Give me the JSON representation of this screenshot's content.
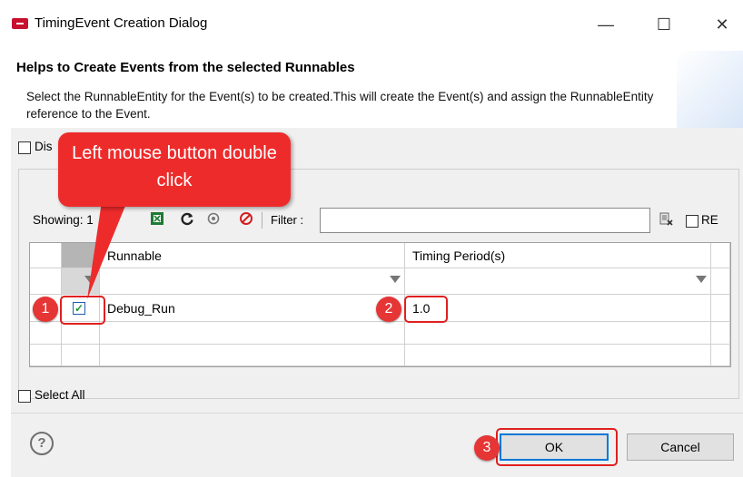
{
  "window": {
    "title": "TimingEvent Creation Dialog",
    "minimize_glyph": "—",
    "maximize_glyph": "☐",
    "close_glyph": "✕"
  },
  "header": {
    "title": "Helps to Create Events from the selected Runnables",
    "description": "Select the RunnableEntity for the Event(s) to be created.This will create the Event(s) and assign the RunnableEntity reference to the Event."
  },
  "options": {
    "display_label": "Dis",
    "select_all_label": "Select All"
  },
  "toolbar": {
    "showing_label": "Showing: 1",
    "filter_label": "Filter :",
    "filter_value": "",
    "re_label": "RE",
    "export_icon": "excel-export-icon",
    "refresh_icon": "refresh-icon",
    "filter_clear_icon": "clear-icon",
    "cancel_icon": "cancel-icon"
  },
  "table": {
    "columns": [
      "Runnable",
      "Timing Period(s)"
    ],
    "rows": [
      {
        "checked": true,
        "runnable": "Debug_Run",
        "period": "1.0"
      }
    ]
  },
  "footer": {
    "help_glyph": "?",
    "ok_label": "OK",
    "cancel_label": "Cancel"
  },
  "annotations": {
    "callout_text": "Left mouse button double click",
    "badges": [
      "1",
      "2",
      "3"
    ]
  },
  "colors": {
    "accent": "#0078d7",
    "annotation_red": "#ee2b2b",
    "dialog_bg": "#f0f0f0"
  }
}
